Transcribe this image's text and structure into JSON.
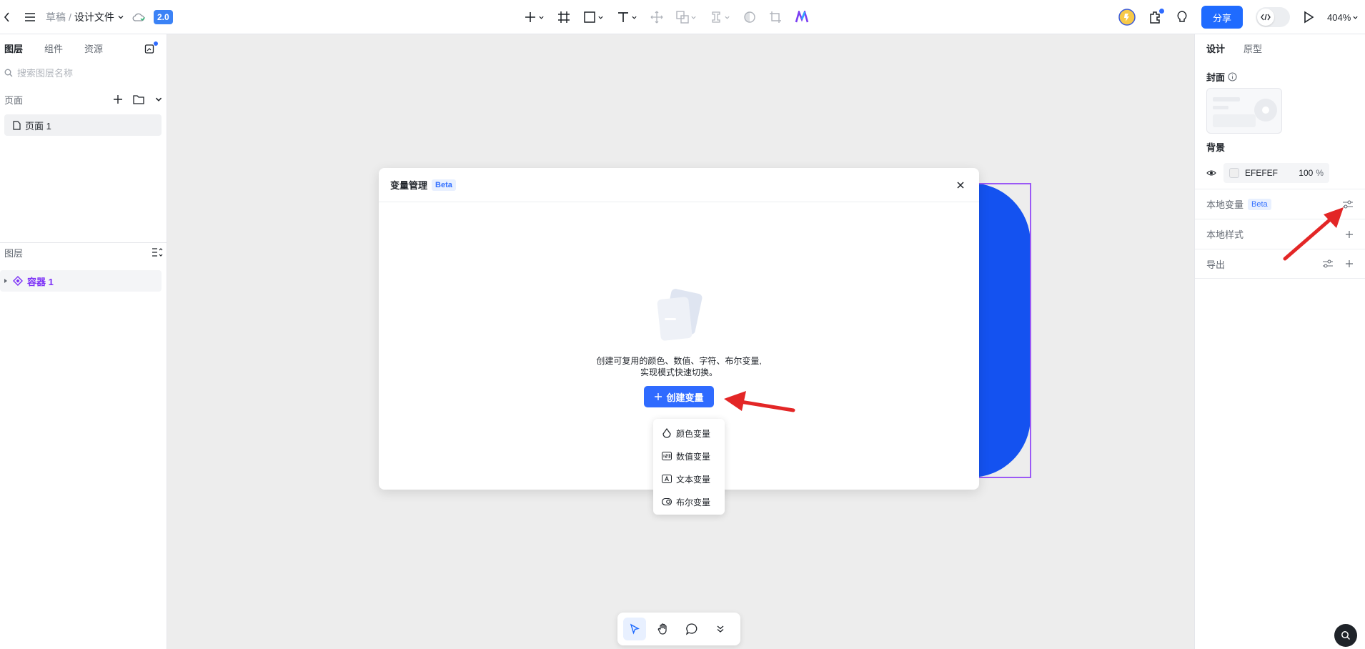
{
  "topbar": {
    "breadcrumb_parent": "草稿",
    "breadcrumb_sep": "/",
    "file_name": "设计文件",
    "version_badge": "2.0",
    "share_label": "分享",
    "zoom_level": "404%"
  },
  "left_panel": {
    "tabs": [
      "图层",
      "组件",
      "资源"
    ],
    "search_placeholder": "搜索图层名称",
    "pages_title": "页面",
    "page_item": "页面 1",
    "layers_title": "图层",
    "layer_item": "容器 1"
  },
  "right_panel": {
    "tabs": [
      "设计",
      "原型"
    ],
    "cover_label": "封面",
    "background_label": "背景",
    "background_hex": "EFEFEF",
    "background_opacity": "100",
    "opacity_unit": "%",
    "local_variables_label": "本地变量",
    "beta_label": "Beta",
    "local_styles_label": "本地样式",
    "export_label": "导出"
  },
  "modal": {
    "title": "变量管理",
    "beta_label": "Beta",
    "empty_line1": "创建可复用的颜色、数值、字符、布尔变量,",
    "empty_line2": "实现模式快速切换。",
    "create_label": "创建变量",
    "menu": [
      "颜色变量",
      "数值变量",
      "文本变量",
      "布尔变量"
    ]
  },
  "colors": {
    "accent": "#1f6bff",
    "frame_fill": "#1452f0",
    "selection": "#9b59f6",
    "annotation_arrow": "#e32626"
  }
}
